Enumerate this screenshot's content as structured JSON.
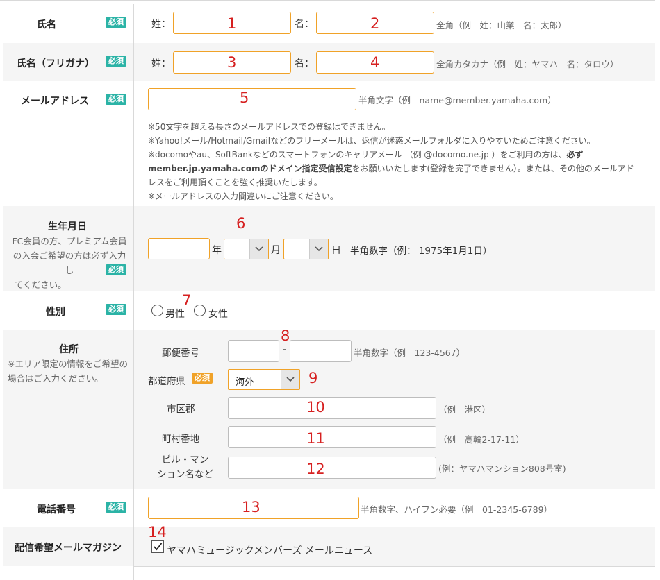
{
  "required_badge": "必須",
  "name": {
    "label": "氏名",
    "sei_label": "姓：",
    "mei_label": "名：",
    "hint": "全角（例　姓：山業　名：太郎）",
    "num_sei": "1",
    "num_mei": "2"
  },
  "kana": {
    "label": "氏名（フリガナ）",
    "sei_label": "姓：",
    "mei_label": "名：",
    "hint": "全角カタカナ（例　姓：ヤマハ　名：タロウ）",
    "num_sei": "3",
    "num_mei": "4"
  },
  "email": {
    "label": "メールアドレス",
    "hint": "半角文字（例　name@member.yamaha.com）",
    "num": "5",
    "note1": "※50文字を超える長さのメールアドレスでの登録はできません。",
    "note2": "※Yahoo!メール/Hotmail/Gmailなどのフリーメールは、返信が迷惑メールフォルダに入りやすいためご注意ください。",
    "note3a": "※docomoやau、SoftBankなどのスマートフォンのキャリアメール （例 @docomo.ne.jp ）をご利用の方は、",
    "note3b": "必ず",
    "note4a": "member.jp.yamaha.comのドメイン指定受信設定",
    "note4b": "をお願いいたします(登録を完了できません）。または、その他のメールアド",
    "note5": "レスをご利用頂くことを強く推奨いたします。",
    "note6": "※メールアドレスの入力間違いにご注意ください。"
  },
  "birth": {
    "label": "生年月日",
    "note1": "FC会員の方、プレミアム会員",
    "note2": "の入会ご希望の方は必ず入力し",
    "note3": "てください。",
    "year_label": "年",
    "month_label": "月",
    "day_label": "日",
    "hint": "半角数字（例： 1975年1月1日）",
    "num": "6"
  },
  "gender": {
    "label": "性別",
    "male": "男性",
    "female": "女性",
    "num": "7"
  },
  "address": {
    "label": "住所",
    "note1": "※エリア限定の情報をご希望の",
    "note2": "場合はご入力ください。",
    "postal_label": "郵便番号",
    "postal_sep": "-",
    "postal_hint": "半角数字（例　123-4567）",
    "num_postal": "8",
    "pref_label": "都道府県",
    "pref_value": "海外",
    "num_pref": "9",
    "city_label": "市区郡",
    "city_hint": "（例　港区）",
    "num_city": "10",
    "street_label": "町村番地",
    "street_hint": "（例　高輪2-17-11）",
    "num_street": "11",
    "building_label1": "ビル・マン",
    "building_label2": "ション名など",
    "building_hint": "(例：ヤマハマンション808号室)",
    "num_building": "12"
  },
  "phone": {
    "label": "電話番号",
    "hint": "半角数字、ハイフン必要（例　01-2345-6789）",
    "num": "13"
  },
  "magazine": {
    "label": "配信希望メールマガジン",
    "option": "ヤマハミュージックメンバーズ メールニュース",
    "checked": true,
    "num": "14"
  },
  "colors": {
    "accent_border": "#f0a228",
    "required_badge": "#2bb3a6",
    "annotation": "#d62020"
  }
}
